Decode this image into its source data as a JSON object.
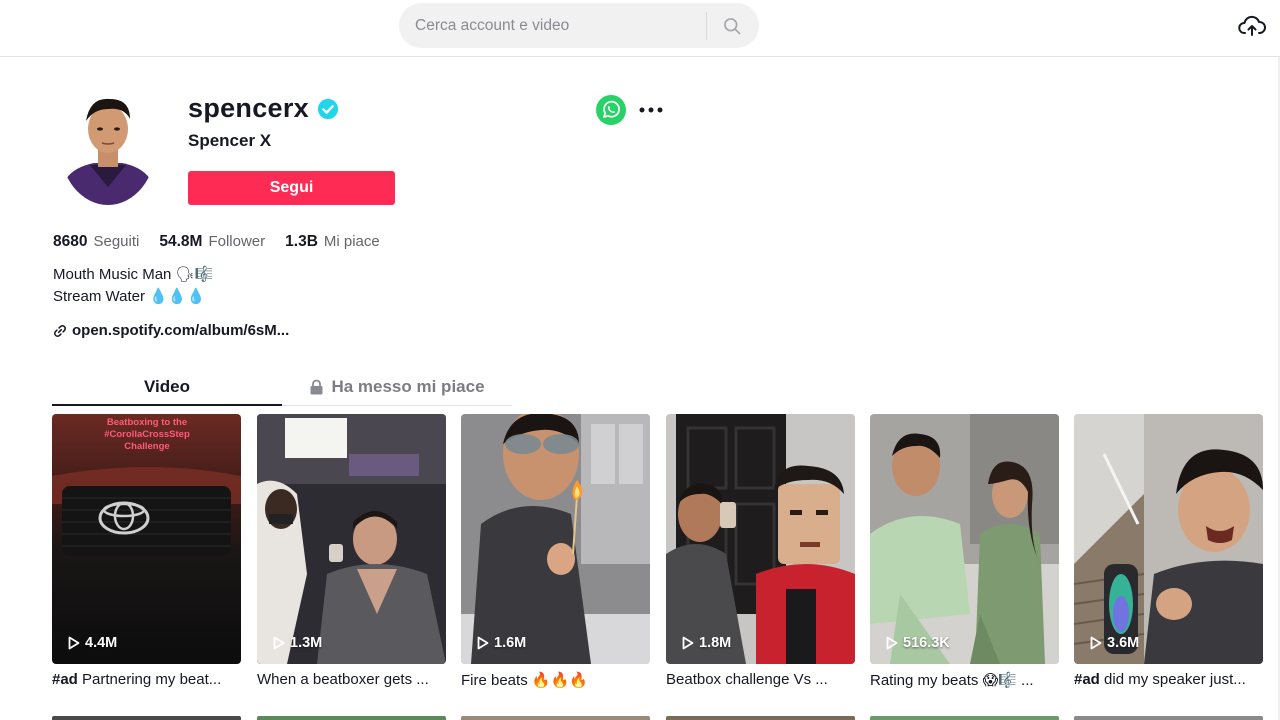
{
  "search": {
    "placeholder": "Cerca account e video"
  },
  "profile": {
    "username": "spencerx",
    "nickname": "Spencer X",
    "follow_label": "Segui",
    "stats": [
      {
        "value": "8680",
        "label": "Seguiti"
      },
      {
        "value": "54.8M",
        "label": "Follower"
      },
      {
        "value": "1.3B",
        "label": "Mi piace"
      }
    ],
    "bio": [
      "Mouth Music Man 🗣🎼",
      "Stream Water 💧💧💧"
    ],
    "link": "open.spotify.com/album/6sM..."
  },
  "tabs": {
    "video": "Video",
    "liked": "Ha messo mi piace"
  },
  "videos": [
    {
      "views": "4.4M",
      "tag": "#ad",
      "caption": " Partnering my beat...",
      "overlay_text": "Beatboxing to the #CorollaCrossStep Challenge"
    },
    {
      "views": "1.3M",
      "tag": "",
      "caption": "When a beatboxer gets ..."
    },
    {
      "views": "1.6M",
      "tag": "",
      "caption": "Fire beats 🔥🔥🔥"
    },
    {
      "views": "1.8M",
      "tag": "",
      "caption": "Beatbox challenge Vs ..."
    },
    {
      "views": "516.3K",
      "tag": "",
      "caption": "Rating my beats 😱🎼 ..."
    },
    {
      "views": "3.6M",
      "tag": "#ad",
      "caption": " did my speaker just..."
    }
  ],
  "colors": {
    "accent": "#fe2c55",
    "verified": "#20d5ec",
    "whatsapp": "#25d366"
  }
}
